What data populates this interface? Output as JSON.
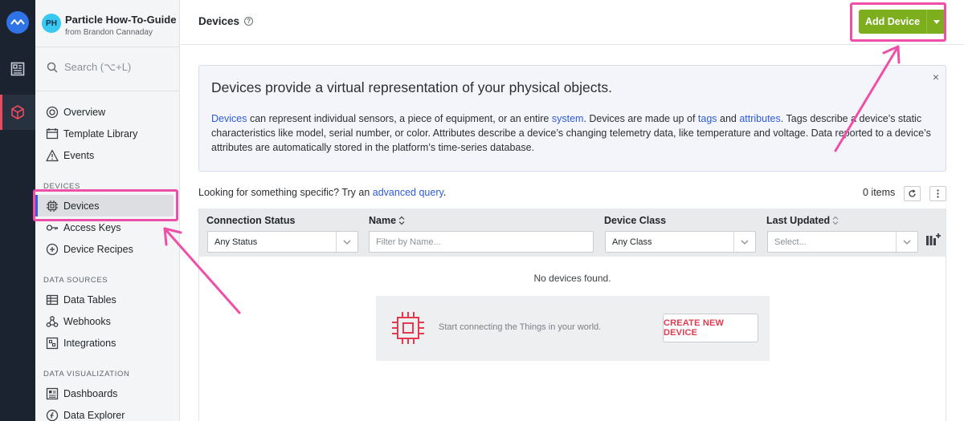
{
  "org": {
    "initials": "PH",
    "name": "Particle How-To-Guide",
    "subtitle": "from Brandon Cannaday"
  },
  "search": {
    "placeholder": "Search (⌥+L)"
  },
  "nav": {
    "overview": "Overview",
    "template_library": "Template Library",
    "events": "Events",
    "devices_section": "DEVICES",
    "devices": "Devices",
    "access_keys": "Access Keys",
    "device_recipes": "Device Recipes",
    "data_sources_section": "DATA SOURCES",
    "data_tables": "Data Tables",
    "webhooks": "Webhooks",
    "integrations": "Integrations",
    "data_visualization_section": "DATA VISUALIZATION",
    "dashboards": "Dashboards",
    "data_explorer": "Data Explorer"
  },
  "header": {
    "title": "Devices",
    "help_icon": "?",
    "add_button": "Add Device"
  },
  "banner": {
    "heading": "Devices provide a virtual representation of your physical objects.",
    "link_devices": "Devices",
    "text_1": " can represent individual sensors, a piece of equipment, or an entire ",
    "link_system": "system",
    "text_2": ". Devices are made up of ",
    "link_tags": "tags",
    "text_3": " and ",
    "link_attributes": "attributes",
    "text_4": ". Tags describe a device’s static characteristics like model, serial number, or color. Attributes describe a device’s changing telemetry data, like temperature and voltage. Data reported to a device’s attributes are automatically stored in the platform’s time-series database.",
    "close": "×"
  },
  "query": {
    "prefix": "Looking for something specific? Try an ",
    "link": "advanced query",
    "suffix": "."
  },
  "count": "0 items",
  "table": {
    "columns": {
      "connection_status": "Connection Status",
      "name": "Name",
      "device_class": "Device Class",
      "last_updated": "Last Updated"
    },
    "filters": {
      "status_value": "Any Status",
      "name_placeholder": "Filter by Name...",
      "class_value": "Any Class",
      "updated_placeholder": "Select..."
    },
    "empty_message": "No devices found.",
    "empty_hint": "Start connecting the Things in your world.",
    "create_button": "CREATE NEW DEVICE"
  },
  "colors": {
    "accent_green": "#7cae1d",
    "link_blue": "#2e5bd9",
    "highlight_pink": "#ee4fa8",
    "create_red": "#e23a4e"
  },
  "icons": [
    "losant-logo-icon",
    "dashboard-icon",
    "cube-icon",
    "search-icon",
    "overview-icon",
    "template-library-icon",
    "events-icon",
    "devices-icon",
    "key-icon",
    "recipe-icon",
    "table-icon",
    "webhook-icon",
    "integration-icon",
    "dashboards-icon",
    "data-explorer-icon",
    "help-icon",
    "caret-down-icon",
    "close-icon",
    "refresh-icon",
    "more-icon",
    "sort-icon",
    "chevron-down-icon",
    "columns-icon",
    "chip-icon"
  ]
}
